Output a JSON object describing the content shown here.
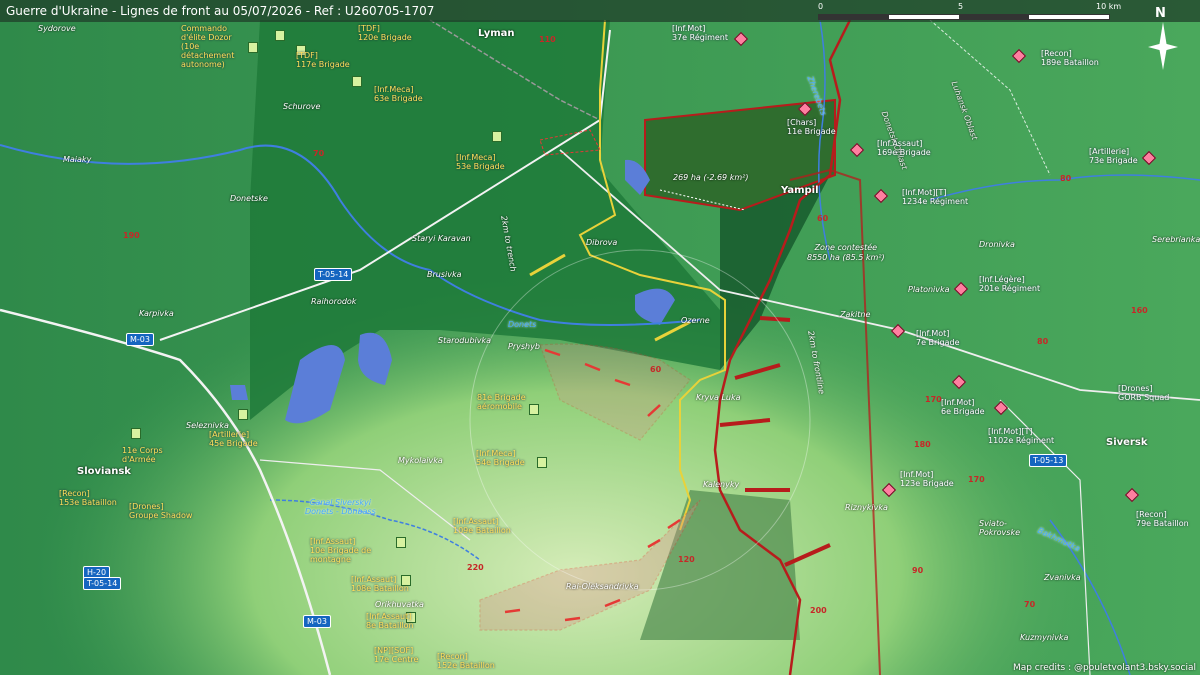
{
  "header": {
    "title": "Guerre d'Ukraine - Lignes de front au 05/07/2026 - Ref : U260705-1707"
  },
  "scale": {
    "ticks": [
      "0",
      "5",
      "10 km"
    ]
  },
  "north": {
    "label": "N"
  },
  "credits": "Map credits : @pouletvolant3.bsky.social",
  "colors": {
    "ukraine_units": "#ffe05a",
    "russia_units": "#ffffff",
    "front_line_red": "#b71c1c",
    "front_line_yellow": "#e8d23a",
    "contested_zone": "#1f6e3a"
  },
  "places": {
    "lyman": "Lyman",
    "yampil": "Yampil",
    "sloviansk": "Sloviansk",
    "siversk": "Siversk",
    "sydorove": "Sydorove",
    "maiaky": "Maiaky",
    "schurove": "Schurove",
    "donetske": "Donetske",
    "staryi_karavan": "Staryi Karavan",
    "brusivka": "Brusivka",
    "raihorodok": "Raihorodok",
    "karpivka": "Karpivka",
    "dibrova": "Dibrova",
    "ozerne": "Ozerne",
    "starodubivka": "Starodubivka",
    "pryshyb": "Pryshyb",
    "kryva_luka": "Kryva Luka",
    "seleznivka": "Seleznivka",
    "mykolaivka": "Mykolaivka",
    "platonivka": "Platonivka",
    "zakitne": "Zakitne",
    "dronivka": "Dronivka",
    "serebrianka": "Serebrianka",
    "kalenyky": "Kalenyky",
    "rai_oleksandrivka": "Rai-Oleksandrivka",
    "orikhuvatka": "Orikhuvatka",
    "riznykivka": "Riznykivka",
    "sviato_pokrovske": "Sviato-\nPokrovske",
    "zvanivka": "Zvanivka",
    "kuzmynivka": "Kuzmynivka",
    "donetsk_oblast": "Donetsk Oblast",
    "luhansk_oblast": "Luhansk Oblast"
  },
  "rivers": {
    "donets": "Donets",
    "zherebets": "Zherebets",
    "canal": "Canal Siverskyi\nDonets - Donbass",
    "bakhmutka": "Bakhmutka"
  },
  "roads": [
    "T-05-14",
    "M-03",
    "H-20",
    "T-05-14",
    "M-03",
    "T-05-13"
  ],
  "altitudes": [
    "190",
    "110",
    "70",
    "60",
    "60",
    "80",
    "160",
    "170",
    "180",
    "170",
    "220",
    "120",
    "90",
    "200",
    "70",
    "80"
  ],
  "notes": {
    "salient_area": "269 ha (-2.69 km²)",
    "contested": "Zone contestée\n8550 ha (85.5 km²)",
    "range_a": "2km to trench",
    "range_b": "2km to frontline"
  },
  "units_ukraine": {
    "dozor": "Commando\nd'élite Dozor\n(10e\ndétachement\nautonome)",
    "tdf120": "[TDF]\n120e Brigade",
    "tdf117": "[TDF]\n117e Brigade",
    "meca63": "[Inf.Meca]\n63e Brigade",
    "meca53": "[Inf.Meca]\n53e Brigade",
    "art45": "[Artillerie]\n45e Brigade",
    "corps11": "11e Corps\nd'Armée",
    "recon153": "[Recon]\n153e Bataillon",
    "drones_shadow": "[Drones]\nGroupe Shadow",
    "aero81": "81e Brigade\naéromobile",
    "meca54": "[Inf.Meca]\n54e Brigade",
    "assaut109": "[Inf.Assaut]\n109e Bataillon",
    "assaut10": "[Inf.Assaut]\n10e Brigade de\nmontagne",
    "assaut108": "[Inf.Assaut]\n108e Bataillon",
    "assaut8": "[Inf.Assaut]\n8e Bataillon",
    "sof17": "[NP][SOF]\n17e Centre",
    "recon152": "[Recon]\n152e Bataillon"
  },
  "units_russia": {
    "mot37": "[Inf.Mot]\n37e Régiment",
    "chars11": "[Chars]\n11e Brigade",
    "assaut169": "[Inf.Assaut]\n169e Brigade",
    "mot1234": "[Inf.Mot][T]\n1234e Régiment",
    "legere201": "[Inf.Légère]\n201e Régiment",
    "mot7": "[Inf.Mot]\n7e Brigade",
    "mot6": "[Inf.Mot]\n6e Brigade",
    "mot1102": "[Inf.Mot][T]\n1102e Régiment",
    "mot123": "[Inf.Mot]\n123e Brigade",
    "recon189": "[Recon]\n189e Bataillon",
    "art73": "[Artillerie]\n73e Brigade",
    "drones_gorb": "[Drones]\nGORB Squad",
    "recon79": "[Recon]\n79e Bataillon"
  }
}
